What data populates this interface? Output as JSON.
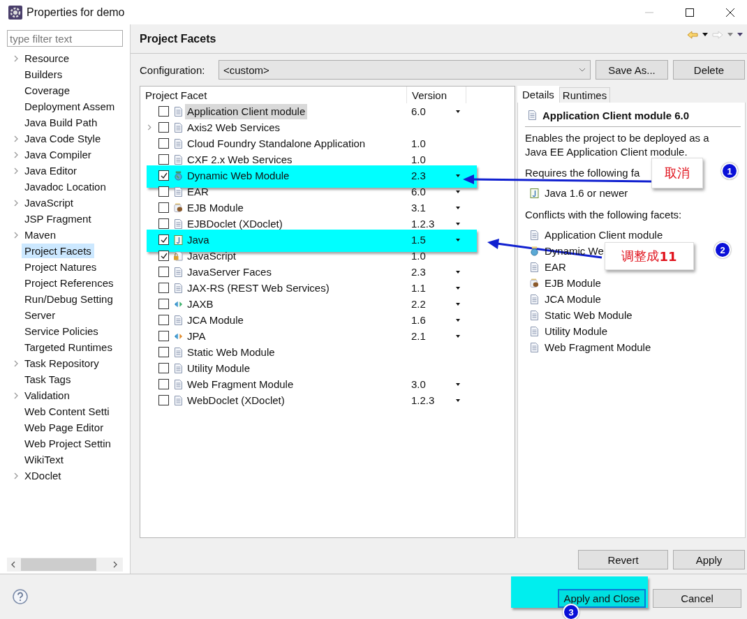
{
  "window": {
    "title": "Properties for demo"
  },
  "filter": {
    "placeholder": "type filter text"
  },
  "sidebar": {
    "items": [
      {
        "label": "Resource",
        "expandable": true,
        "selected": false
      },
      {
        "label": "Builders",
        "expandable": false,
        "selected": false
      },
      {
        "label": "Coverage",
        "expandable": false,
        "selected": false
      },
      {
        "label": "Deployment Assem",
        "expandable": false,
        "selected": false
      },
      {
        "label": "Java Build Path",
        "expandable": false,
        "selected": false
      },
      {
        "label": "Java Code Style",
        "expandable": true,
        "selected": false
      },
      {
        "label": "Java Compiler",
        "expandable": true,
        "selected": false
      },
      {
        "label": "Java Editor",
        "expandable": true,
        "selected": false
      },
      {
        "label": "Javadoc Location",
        "expandable": false,
        "selected": false
      },
      {
        "label": "JavaScript",
        "expandable": true,
        "selected": false
      },
      {
        "label": "JSP Fragment",
        "expandable": false,
        "selected": false
      },
      {
        "label": "Maven",
        "expandable": true,
        "selected": false
      },
      {
        "label": "Project Facets",
        "expandable": false,
        "selected": true
      },
      {
        "label": "Project Natures",
        "expandable": false,
        "selected": false
      },
      {
        "label": "Project References",
        "expandable": false,
        "selected": false
      },
      {
        "label": "Run/Debug Setting",
        "expandable": false,
        "selected": false
      },
      {
        "label": "Server",
        "expandable": false,
        "selected": false
      },
      {
        "label": "Service Policies",
        "expandable": false,
        "selected": false
      },
      {
        "label": "Targeted Runtimes",
        "expandable": false,
        "selected": false
      },
      {
        "label": "Task Repository",
        "expandable": true,
        "selected": false
      },
      {
        "label": "Task Tags",
        "expandable": false,
        "selected": false
      },
      {
        "label": "Validation",
        "expandable": true,
        "selected": false
      },
      {
        "label": "Web Content Setti",
        "expandable": false,
        "selected": false
      },
      {
        "label": "Web Page Editor",
        "expandable": false,
        "selected": false
      },
      {
        "label": "Web Project Settin",
        "expandable": false,
        "selected": false
      },
      {
        "label": "WikiText",
        "expandable": false,
        "selected": false
      },
      {
        "label": "XDoclet",
        "expandable": true,
        "selected": false
      }
    ]
  },
  "page": {
    "title": "Project Facets"
  },
  "configuration": {
    "label": "Configuration:",
    "value": "<custom>",
    "save_as": "Save As...",
    "delete": "Delete"
  },
  "facets": {
    "columns": [
      "Project Facet",
      "Version"
    ],
    "rows": [
      {
        "name": "Application Client module",
        "checked": false,
        "version": "6.0",
        "has_menu": true,
        "kind": "page",
        "expandable": false,
        "selected": true,
        "highlighted": false
      },
      {
        "name": "Axis2 Web Services",
        "checked": false,
        "has_menu": false,
        "kind": "page",
        "expandable": true,
        "selected": false,
        "highlighted": false
      },
      {
        "name": "Cloud Foundry Standalone Application",
        "checked": false,
        "version": "1.0",
        "has_menu": false,
        "kind": "page",
        "expandable": false,
        "selected": false,
        "highlighted": false
      },
      {
        "name": "CXF 2.x Web Services",
        "checked": false,
        "version": "1.0",
        "has_menu": false,
        "kind": "page",
        "expandable": false,
        "selected": false,
        "highlighted": false
      },
      {
        "name": "Dynamic Web Module",
        "checked": true,
        "version": "2.3",
        "has_menu": true,
        "kind": "globe",
        "expandable": false,
        "selected": false,
        "highlighted": true
      },
      {
        "name": "EAR",
        "checked": false,
        "version": "6.0",
        "has_menu": true,
        "kind": "page",
        "expandable": false,
        "selected": false,
        "highlighted": false
      },
      {
        "name": "EJB Module",
        "checked": false,
        "version": "3.1",
        "has_menu": true,
        "kind": "bean",
        "expandable": false,
        "selected": false,
        "highlighted": false
      },
      {
        "name": "EJBDoclet (XDoclet)",
        "checked": false,
        "version": "1.2.3",
        "has_menu": true,
        "kind": "page",
        "expandable": false,
        "selected": false,
        "highlighted": false
      },
      {
        "name": "Java",
        "checked": true,
        "version": "1.5",
        "has_menu": true,
        "kind": "java",
        "expandable": false,
        "selected": false,
        "highlighted": true
      },
      {
        "name": "JavaScript",
        "checked": true,
        "version": "1.0",
        "has_menu": false,
        "kind": "locked",
        "expandable": false,
        "selected": false,
        "highlighted": false
      },
      {
        "name": "JavaServer Faces",
        "checked": false,
        "version": "2.3",
        "has_menu": true,
        "kind": "page",
        "expandable": false,
        "selected": false,
        "highlighted": false
      },
      {
        "name": "JAX-RS (REST Web Services)",
        "checked": false,
        "version": "1.1",
        "has_menu": true,
        "kind": "page",
        "expandable": false,
        "selected": false,
        "highlighted": false
      },
      {
        "name": "JAXB",
        "checked": false,
        "version": "2.2",
        "has_menu": true,
        "kind": "binding",
        "expandable": false,
        "selected": false,
        "highlighted": false
      },
      {
        "name": "JCA Module",
        "checked": false,
        "version": "1.6",
        "has_menu": true,
        "kind": "page",
        "expandable": false,
        "selected": false,
        "highlighted": false
      },
      {
        "name": "JPA",
        "checked": false,
        "version": "2.1",
        "has_menu": true,
        "kind": "persistence",
        "expandable": false,
        "selected": false,
        "highlighted": false
      },
      {
        "name": "Static Web Module",
        "checked": false,
        "has_menu": false,
        "kind": "page",
        "expandable": false,
        "selected": false,
        "highlighted": false
      },
      {
        "name": "Utility Module",
        "checked": false,
        "has_menu": false,
        "kind": "page",
        "expandable": false,
        "selected": false,
        "highlighted": false
      },
      {
        "name": "Web Fragment Module",
        "checked": false,
        "version": "3.0",
        "has_menu": true,
        "kind": "page",
        "expandable": false,
        "selected": false,
        "highlighted": false
      },
      {
        "name": "WebDoclet (XDoclet)",
        "checked": false,
        "version": "1.2.3",
        "has_menu": true,
        "kind": "page",
        "expandable": false,
        "selected": false,
        "highlighted": false
      }
    ]
  },
  "details": {
    "tabs": [
      {
        "label": "Details",
        "selected": true
      },
      {
        "label": "Runtimes",
        "selected": false
      }
    ],
    "title": "Application Client module 6.0",
    "description": "Enables the project to be deployed as a Java EE Application Client module.",
    "requires_label": "Requires the following fa",
    "requires": [
      {
        "name": "Java 1.6 or newer",
        "kind": "java"
      }
    ],
    "conflicts_label": "Conflicts with the following facets:",
    "conflicts": [
      {
        "name": "Application Client module",
        "kind": "page"
      },
      {
        "name": "Dynamic We",
        "kind": "globe"
      },
      {
        "name": "EAR",
        "kind": "page"
      },
      {
        "name": "EJB Module",
        "kind": "bean"
      },
      {
        "name": "JCA Module",
        "kind": "page"
      },
      {
        "name": "Static Web Module",
        "kind": "page"
      },
      {
        "name": "Utility Module",
        "kind": "page"
      },
      {
        "name": "Web Fragment Module",
        "kind": "page"
      }
    ]
  },
  "buttons": {
    "revert": "Revert",
    "apply": "Apply"
  },
  "footer": {
    "apply_close": "Apply and Close",
    "cancel": "Cancel"
  },
  "annotations": {
    "callouts": [
      "取消",
      "调整成**11**"
    ],
    "badges": [
      "1",
      "2",
      "3"
    ]
  }
}
